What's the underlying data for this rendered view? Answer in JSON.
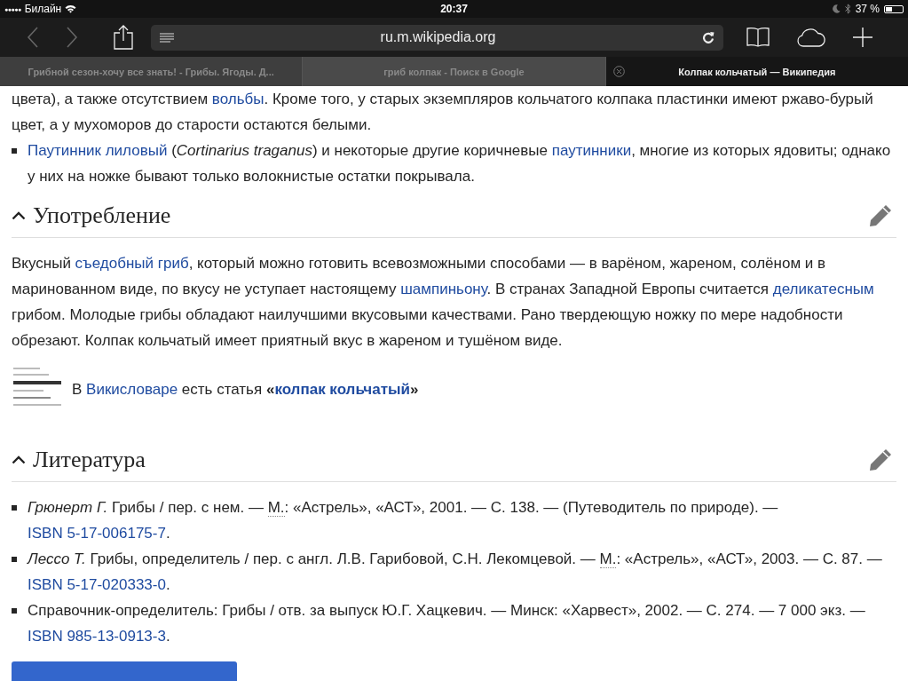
{
  "status_bar": {
    "signal": "●●●●●",
    "carrier": "Билайн",
    "time": "20:37",
    "battery": "37 %"
  },
  "toolbar": {
    "address": "ru.m.wikipedia.org"
  },
  "tabs": [
    {
      "title": "Грибной сезон-хочу все знать! - Грибы. Ягоды. Д...",
      "selected": false
    },
    {
      "title": "гриб колпак - Поиск в Google",
      "selected": false
    },
    {
      "title": "Колпак кольчатый — Википедия",
      "selected": true
    }
  ],
  "intro": [
    {
      "kind": "paragraph",
      "segments": [
        {
          "kind": "t",
          "text": "цвета), а также отсутствием "
        },
        {
          "kind": "link",
          "text": "вольбы"
        },
        {
          "kind": "t",
          "text": ". Кроме того, у старых экземпляров кольчатого колпака пластинки имеют ржаво-бурый цвет, а у мухоморов до старости остаются белыми."
        }
      ]
    },
    {
      "kind": "bullet",
      "segments": [
        {
          "kind": "link",
          "text": "Паутинник лиловый"
        },
        {
          "kind": "t",
          "text": " ("
        },
        {
          "kind": "i",
          "text": "Cortinarius traganus"
        },
        {
          "kind": "t",
          "text": ") и некоторые другие коричневые "
        },
        {
          "kind": "link",
          "text": "паутинники"
        },
        {
          "kind": "t",
          "text": ", многие из которых ядовиты; однако у них на ножке бывают только волокнистые остатки покрывала."
        }
      ]
    }
  ],
  "sections": [
    {
      "heading": "Употребление",
      "blocks": [
        {
          "kind": "paragraph",
          "segments": [
            {
              "kind": "t",
              "text": "Вкусный "
            },
            {
              "kind": "link",
              "text": "съедобный гриб"
            },
            {
              "kind": "t",
              "text": ", который можно готовить всевозможными способами — в варёном, жареном, солёном и в маринованном виде, по вкусу не уступает настоящему "
            },
            {
              "kind": "link",
              "text": "шампиньону"
            },
            {
              "kind": "t",
              "text": ". В странах Западной Европы считается "
            },
            {
              "kind": "link",
              "text": "деликатесным"
            },
            {
              "kind": "t",
              "text": " грибом. Молодые грибы обладают наилучшими вкусовыми качествами. Рано твердеющую ножку по мере надобности обрезают. Колпак кольчатый имеет приятный вкус в жареном и тушёном виде."
            }
          ]
        },
        {
          "kind": "wikt",
          "segments": [
            {
              "kind": "t",
              "text": "В "
            },
            {
              "kind": "link",
              "text": "Викисловаре"
            },
            {
              "kind": "t",
              "text": " есть статья "
            },
            {
              "kind": "b",
              "text": "«"
            },
            {
              "kind": "bl",
              "text": "колпак кольчатый"
            },
            {
              "kind": "b",
              "text": "»"
            }
          ]
        }
      ]
    },
    {
      "heading": "Литература",
      "blocks": [
        {
          "kind": "bullet",
          "segments": [
            {
              "kind": "i",
              "text": "Грюнерт Г."
            },
            {
              "kind": "t",
              "text": " Грибы / пер. с нем. — "
            },
            {
              "kind": "abbr",
              "text": "М."
            },
            {
              "kind": "t",
              "text": ": «Астрель», «АСТ», 2001. — С. 138. — (Путеводитель по природе). — "
            },
            {
              "kind": "link",
              "text": "ISBN 5-17-006175-7"
            },
            {
              "kind": "t",
              "text": "."
            }
          ]
        },
        {
          "kind": "bullet",
          "segments": [
            {
              "kind": "i",
              "text": "Лессо Т."
            },
            {
              "kind": "t",
              "text": " Грибы, определитель / пер. с англ. Л.В. Гарибовой, С.Н. Лекомцевой. — "
            },
            {
              "kind": "abbr",
              "text": "М."
            },
            {
              "kind": "t",
              "text": ": «Астрель», «АСТ», 2003. — С. 87. — "
            },
            {
              "kind": "link",
              "text": "ISBN 5-17-020333-0"
            },
            {
              "kind": "t",
              "text": "."
            }
          ]
        },
        {
          "kind": "bullet",
          "segments": [
            {
              "kind": "t",
              "text": "Справочник-определитель: Грибы / отв. за выпуск Ю.Г. Хацкевич. — Минск: «Харвест», 2002. — С. 274. — 7 000 экз. — "
            },
            {
              "kind": "link",
              "text": "ISBN 985-13-0913-3"
            },
            {
              "kind": "t",
              "text": "."
            }
          ]
        }
      ]
    }
  ]
}
